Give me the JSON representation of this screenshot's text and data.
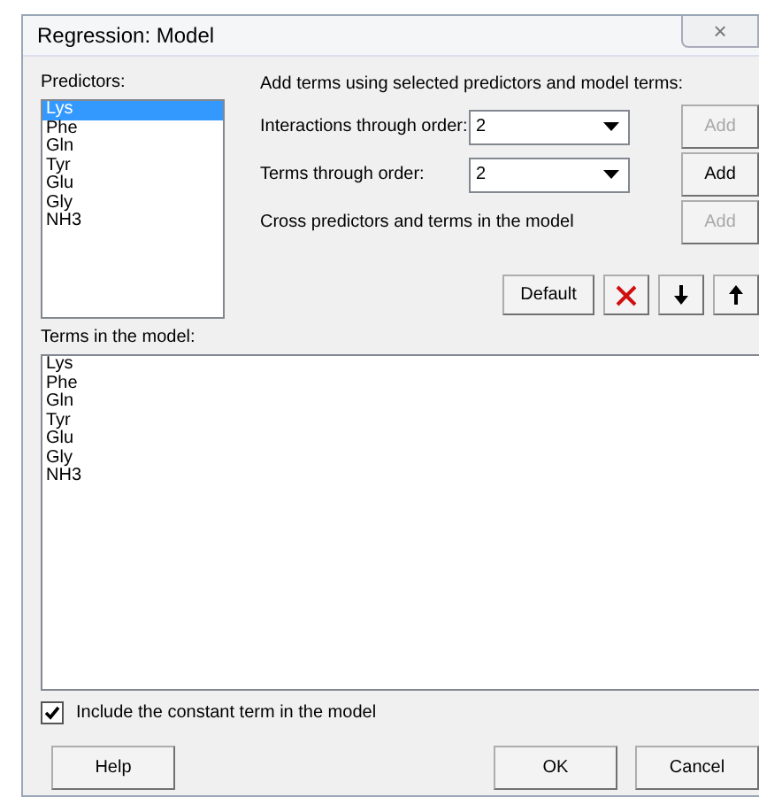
{
  "window": {
    "title": "Regression: Model",
    "close": "×"
  },
  "predictors": {
    "label": "Predictors:",
    "items": [
      {
        "name": "Lys",
        "selected": true
      },
      {
        "name": "Phe",
        "selected": false
      },
      {
        "name": "Gln",
        "selected": false
      },
      {
        "name": "Tyr",
        "selected": false
      },
      {
        "name": "Glu",
        "selected": false
      },
      {
        "name": "Gly",
        "selected": false
      },
      {
        "name": "NH3",
        "selected": false
      }
    ]
  },
  "add_terms": {
    "heading": "Add terms using selected predictors and model terms:",
    "rows": [
      {
        "kind": "combo",
        "label": "Interactions through order:",
        "value": "2",
        "button": "Add",
        "disabled": true
      },
      {
        "kind": "combo",
        "label": "Terms through order:",
        "value": "2",
        "button": "Add",
        "disabled": false
      },
      {
        "kind": "plain",
        "label": "Cross predictors and terms in the model",
        "button": "Add",
        "disabled": true
      }
    ]
  },
  "toolbar": {
    "default_button": "Default"
  },
  "terms": {
    "label": "Terms in the model:",
    "items": [
      "Lys",
      "Phe",
      "Gln",
      "Tyr",
      "Glu",
      "Gly",
      "NH3"
    ]
  },
  "constant": {
    "label": "Include the constant term in the model",
    "checked": true
  },
  "buttons": {
    "help": "Help",
    "ok": "OK",
    "cancel": "Cancel"
  }
}
